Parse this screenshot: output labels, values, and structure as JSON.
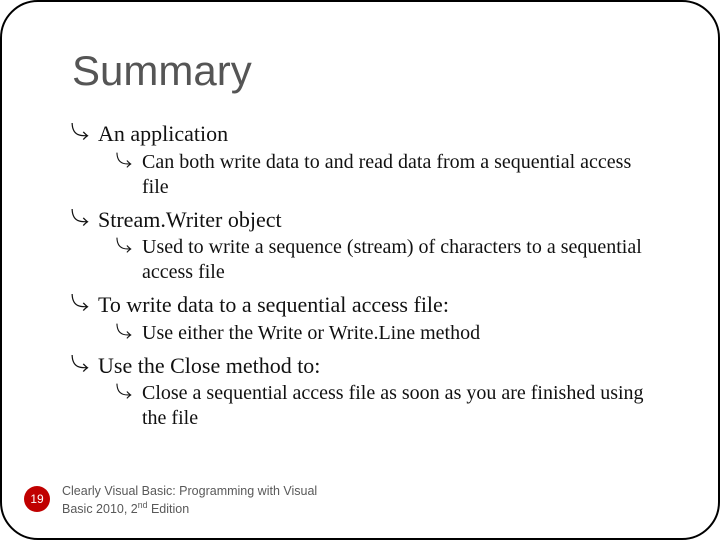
{
  "title": "Summary",
  "bullets": {
    "b1": "An application",
    "b1a": "Can both write data to and read data from a sequential access file",
    "b2": "Stream.Writer object",
    "b2a": "Used to write a sequence (stream) of characters to a sequential access file",
    "b3": "To write data to a sequential access file:",
    "b3a": "Use either the Write or Write.Line method",
    "b4": "Use the Close method to:",
    "b4a": "Close a sequential access file as soon as you are finished using the file"
  },
  "page_number": "19",
  "footer_line1": "Clearly Visual Basic: Programming with Visual",
  "footer_line2_pre": "Basic 2010, 2",
  "footer_line2_sup": "nd",
  "footer_line2_post": " Edition"
}
